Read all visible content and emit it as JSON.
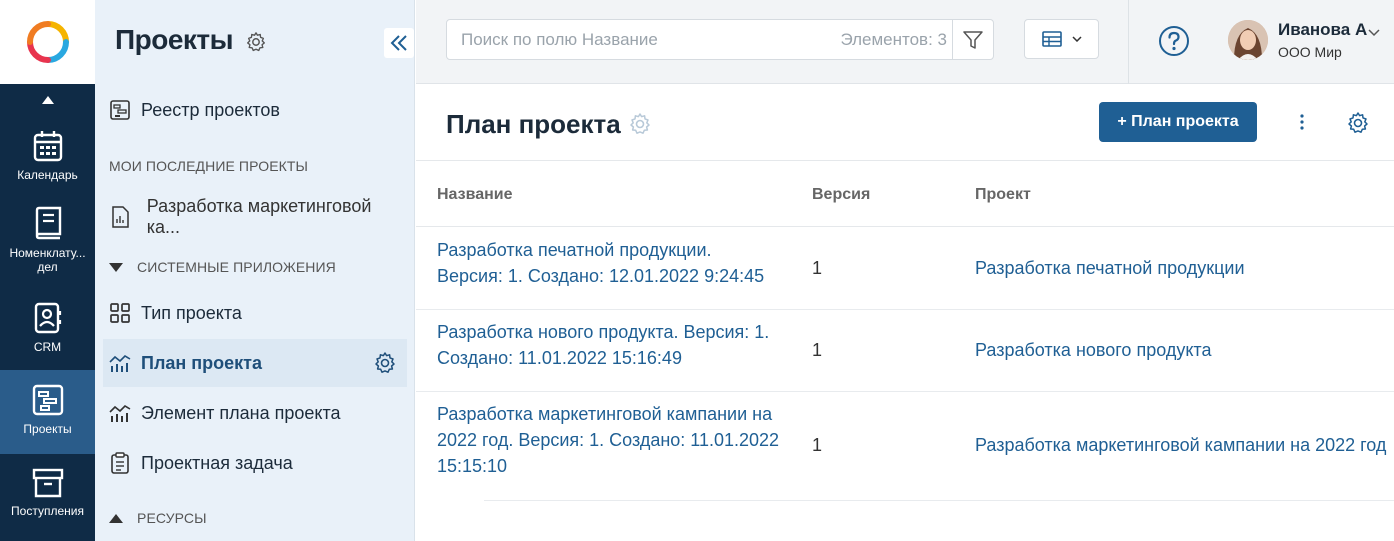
{
  "rail": {
    "items": [
      {
        "label": "Календарь"
      },
      {
        "label": "Номенклату... дел"
      },
      {
        "label": "CRM"
      },
      {
        "label": "Проекты"
      },
      {
        "label": "Поступления"
      }
    ]
  },
  "sidebar": {
    "title": "Проекты",
    "registry": "Реестр проектов",
    "recent_section": "МОИ ПОСЛЕДНИЕ ПРОЕКТЫ",
    "recent_item": "Разработка маркетинговой ка...",
    "system_section": "СИСТЕМНЫЕ ПРИЛОЖЕНИЯ",
    "apps": [
      {
        "label": "Тип проекта"
      },
      {
        "label": "План проекта"
      },
      {
        "label": "Элемент плана проекта"
      },
      {
        "label": "Проектная задача"
      }
    ],
    "resources_section": "РЕСУРСЫ"
  },
  "topbar": {
    "search_placeholder": "Поиск по полю Название",
    "count": "Элементов: 3",
    "user_name": "Иванова А",
    "user_org": "ООО Мир"
  },
  "main": {
    "title": "План проекта",
    "add_button": "+ План проекта",
    "columns": {
      "name": "Название",
      "version": "Версия",
      "project": "Проект"
    },
    "rows": [
      {
        "name": "Разработка печатной продукции. Версия: 1. Создано: 12.01.2022 9:24:45",
        "version": "1",
        "project": "Разработка печатной продукции"
      },
      {
        "name": "Разработка нового продукта. Версия: 1. Создано: 11.01.2022 15:16:49",
        "version": "1",
        "project": "Разработка нового продукта"
      },
      {
        "name": "Разработка маркетинговой кампании на 2022 год. Версия: 1. Создано: 11.01.2022 15:15:10",
        "version": "1",
        "project": "Разработка маркетинговой кампании на 2022 год"
      }
    ]
  },
  "colors": {
    "rail_bg": "#0f2b46",
    "rail_active": "#2a5c8a",
    "accent": "#1f5f94",
    "sidebar_bg": "#e9f1f9"
  }
}
